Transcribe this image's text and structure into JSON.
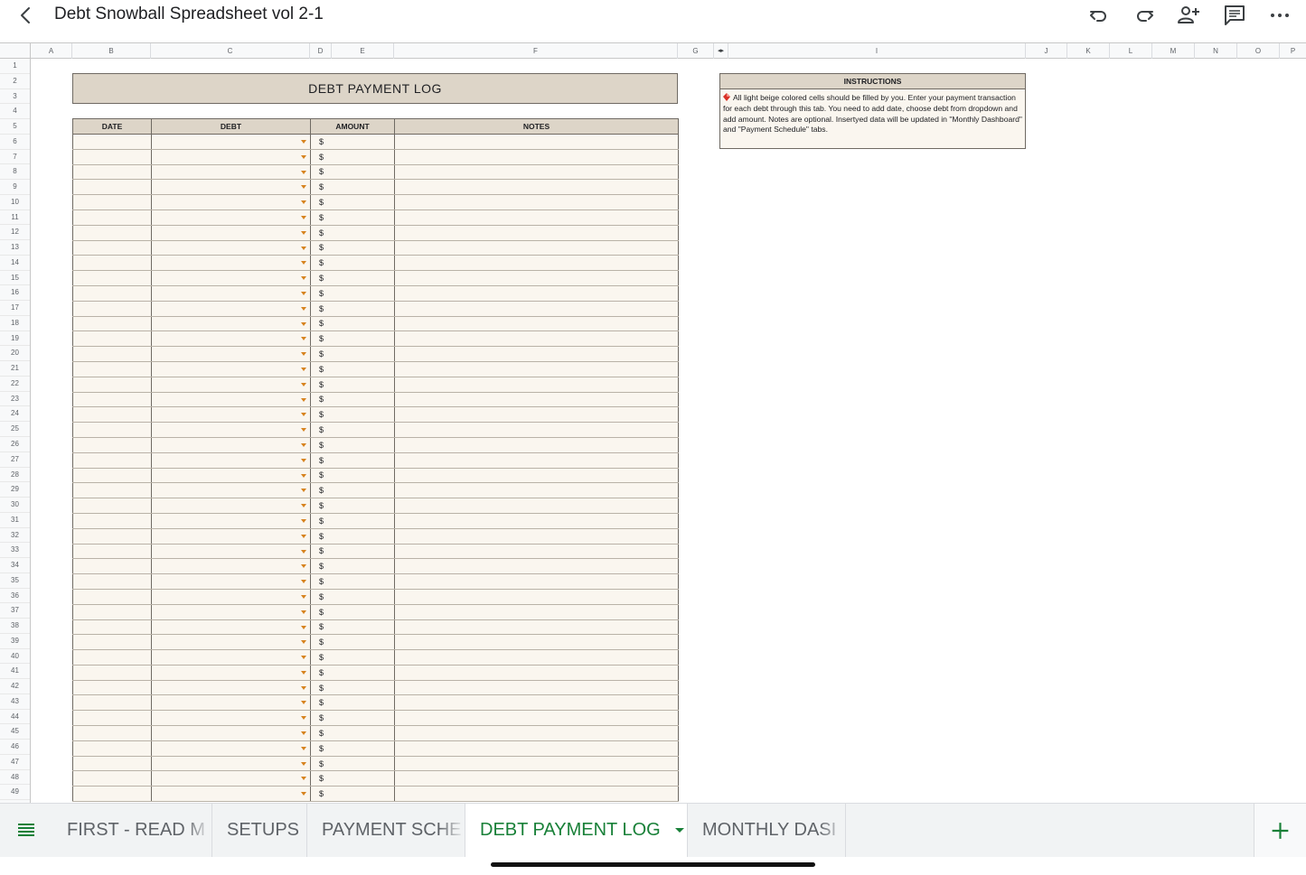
{
  "header": {
    "title": "Debt Snowball Spreadsheet vol 2-1",
    "back_icon": "chevron-left-icon",
    "undo_icon": "undo-icon",
    "redo_icon": "redo-icon",
    "share_icon": "add-person-icon",
    "comment_icon": "comment-icon",
    "more_icon": "more-horizontal-icon"
  },
  "columns": [
    "A",
    "B",
    "C",
    "D",
    "E",
    "F",
    "G",
    "I",
    "J",
    "K",
    "L",
    "M",
    "N",
    "O",
    "P"
  ],
  "rows": [
    "1",
    "2",
    "3",
    "4",
    "5",
    "6",
    "7",
    "8",
    "9",
    "10",
    "11",
    "12",
    "13",
    "14",
    "15",
    "16",
    "17",
    "18",
    "19",
    "20",
    "21",
    "22",
    "23",
    "24",
    "25",
    "26",
    "27",
    "28",
    "29",
    "30",
    "31",
    "32",
    "33",
    "34",
    "35",
    "36",
    "37",
    "38",
    "39",
    "40",
    "41",
    "42",
    "43",
    "44",
    "45",
    "46",
    "47",
    "48",
    "49"
  ],
  "log": {
    "title": "DEBT PAYMENT LOG",
    "headers": {
      "date": "DATE",
      "debt": "DEBT",
      "amount": "AMOUNT",
      "notes": "NOTES"
    },
    "currency": "$",
    "row_count": 44
  },
  "instructions": {
    "title": "INSTRUCTIONS",
    "body": "All light beige colored cells should be filled by you. Enter your payment transaction for each debt through this tab. You need to add date, choose debt from dropdown and add amount. Notes are optional. Insertyed data will be updated in \"Monthly Dashboard\" and \"Payment Schedule\" tabs."
  },
  "sheet_tabs": [
    {
      "label": "FIRST - READ M",
      "active": false
    },
    {
      "label": "SETUPS",
      "active": false
    },
    {
      "label": "PAYMENT SCHE",
      "active": false
    },
    {
      "label": "DEBT PAYMENT LOG",
      "active": true
    },
    {
      "label": "MONTHLY DASI",
      "active": false
    }
  ],
  "colors": {
    "accent_green": "#188038",
    "beige": "#ddd5c8",
    "light_beige": "#faf6ef",
    "caret_orange": "#d7831f"
  }
}
